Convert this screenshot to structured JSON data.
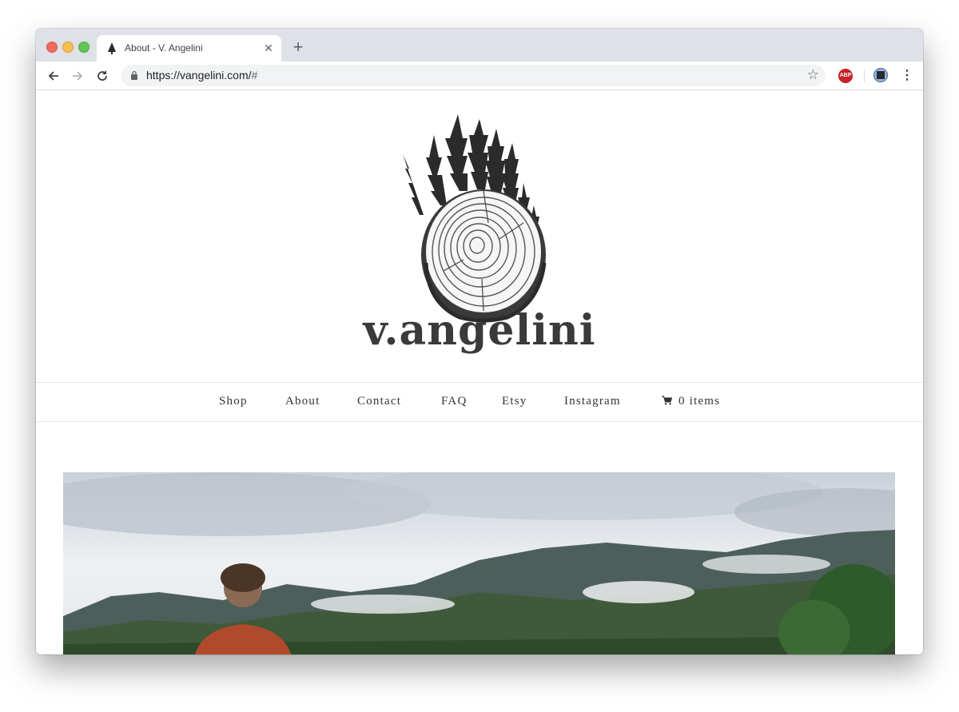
{
  "browser": {
    "tab_title": "About - V. Angelini",
    "url_host": "https://vangelini.com/",
    "url_rest": "#",
    "extension_label": "ABP"
  },
  "site": {
    "brand": "v.angelini",
    "nav": [
      "Shop",
      "About",
      "Contact",
      "FAQ",
      "Etsy",
      "Instagram"
    ],
    "cart_label": "0 items"
  },
  "colors": {
    "tabstrip": "#dee1e6",
    "omnibox": "#f1f3f4",
    "abp_red": "#c82127",
    "nav_text": "#333333"
  },
  "icons": {
    "back": "arrow-left-icon",
    "forward": "arrow-right-icon",
    "reload": "reload-icon",
    "bookmark": "star-icon",
    "cart": "cart-icon"
  }
}
